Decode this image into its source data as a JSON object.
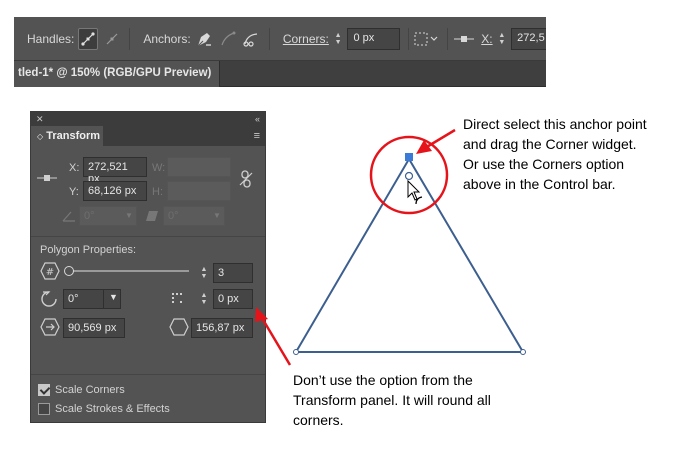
{
  "control_bar": {
    "handles_label": "Handles:",
    "anchors_label": "Anchors:",
    "corners_label": "Corners:",
    "corners_value": "0 px",
    "x_label": "X:",
    "x_value": "272,5"
  },
  "document_tab": {
    "title": "tled-1* @ 150% (RGB/GPU Preview)"
  },
  "transform_panel": {
    "close_glyph": "✕",
    "collapse_glyph": "«",
    "tab_label": "Transform",
    "menu_glyph": "≡",
    "x_label": "X:",
    "x_value": "272,521 px",
    "y_label": "Y:",
    "y_value": "68,126 px",
    "w_label": "W:",
    "h_label": "H:",
    "angle_value": "0°",
    "shear_value": "0°",
    "polygon_header": "Polygon Properties:",
    "side_count": "3",
    "rotation_value": "0°",
    "corner_radius_value": "0 px",
    "side_length_value": "90,569 px",
    "radius_value": "156,87 px",
    "scale_corners_label": "Scale Corners",
    "scale_corners_checked": true,
    "scale_strokes_label": "Scale Strokes & Effects",
    "scale_strokes_checked": false
  },
  "annotations": {
    "anchor_note": [
      "Direct select this anchor point",
      "and drag the Corner widget.",
      "Or use the Corners option",
      "above in the Control bar."
    ],
    "panel_note": [
      "Don’t use the option from the",
      "Transform panel. It will round all",
      "corners."
    ]
  },
  "colors": {
    "highlight_red": "#e5141b",
    "triangle_stroke": "#3d5f8f",
    "anchor_selected": "#3b7bd8",
    "ui_panel": "#535353"
  }
}
